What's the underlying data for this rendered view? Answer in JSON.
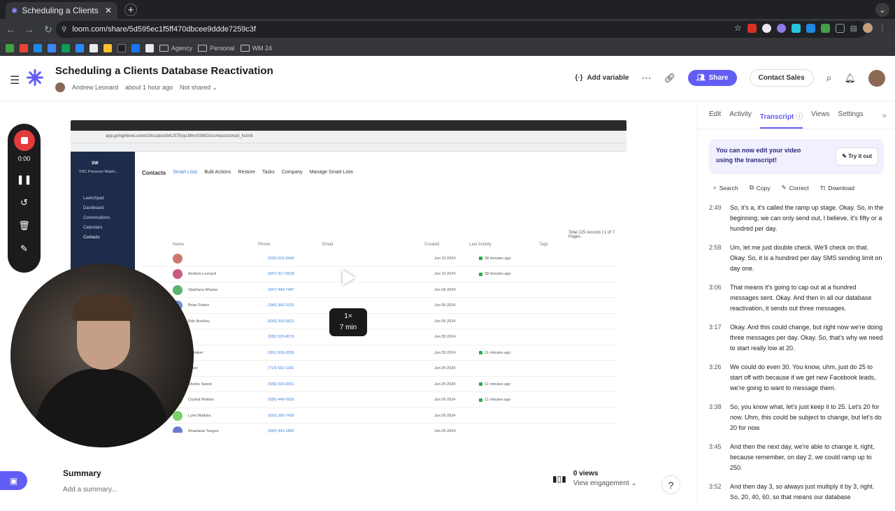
{
  "browser": {
    "tab_title": "Scheduling a Clients Database",
    "url": "loom.com/share/5d595ec1f5ff470dbcee9ddde7259c3f",
    "bookmarks": [
      "Agency",
      "Personal",
      "WM 24"
    ]
  },
  "header": {
    "title": "Scheduling a Clients Database Reactivation",
    "author": "Andrew Leonard",
    "time_ago": "about 1 hour ago",
    "share_status": "Not shared",
    "add_variable": "Add variable",
    "share_label": "Share",
    "contact_sales": "Contact Sales"
  },
  "recorder": {
    "time": "0:00"
  },
  "video": {
    "speed": "1×",
    "duration": "7 min",
    "inner_url": "app.gohighlevel.com/v2/location/bKzS75oyLf8hxXSMGA/contacts/smart_list/All",
    "inner_company": "TRC Pressure Washi...",
    "inner_nav": [
      "Launchpad",
      "Dashboard",
      "Conversations",
      "Calendars",
      "Contacts"
    ],
    "inner_tabs": [
      "Contacts",
      "Smart Lists",
      "Bulk Actions",
      "Restore",
      "Tasks",
      "Company",
      "Manage Smart Lists"
    ],
    "inner_total": "Total 125 records | 1 of 7 Pages",
    "inner_headers": [
      "Name",
      "Phone",
      "Email",
      "Created",
      "Last Activity",
      "Tags"
    ],
    "rows": [
      {
        "name": "",
        "phone": "(936) 525-9440",
        "created": "Jun 10 2024",
        "activity": "38 minutes ago",
        "color": "#c97a6b"
      },
      {
        "name": "Andrew Leonard",
        "phone": "(847) 917-6528",
        "created": "Jun 10 2024",
        "activity": "38 minutes ago",
        "color": "#c85c7a"
      },
      {
        "name": "Stephany Aframe",
        "phone": "(347) 440-7487",
        "created": "Jun 06 2024",
        "activity": "",
        "color": "#5ab36e"
      },
      {
        "name": "Brian Patton",
        "phone": "(346) 366-3102",
        "created": "Jun 06 2024",
        "activity": "",
        "color": "#6b8fd1"
      },
      {
        "name": "Rob Buckley",
        "phone": "(830) 203-9912",
        "created": "Jun 06 2024",
        "activity": "",
        "color": "#d1996b"
      },
      {
        "name": "",
        "phone": "(936) 520-8079",
        "created": "Jun 05 2024",
        "activity": "",
        "color": "#8a6bd1"
      },
      {
        "name": "Whitaker",
        "phone": "(281) 536-0335",
        "created": "Jun 05 2024",
        "activity": "11 minutes ago",
        "color": "#6bb5d1"
      },
      {
        "name": "Zeker",
        "phone": "(713) 562-1166",
        "created": "Jun 05 2024",
        "activity": "",
        "color": "#d16b9e"
      },
      {
        "name": "Shirlee Sweet",
        "phone": "(936) 520-6551",
        "created": "Jun 05 2024",
        "activity": "11 minutes ago",
        "color": "#6bd19e"
      },
      {
        "name": "Crystal Weldon",
        "phone": "(936) 449-0929",
        "created": "Jun 05 2024",
        "activity": "11 minutes ago",
        "color": "#d1c46b"
      },
      {
        "name": "Lynn Watkins",
        "phone": "(816) 390-7430",
        "created": "Jun 05 2024",
        "activity": "",
        "color": "#7ad16b"
      },
      {
        "name": "Anastasia Teague",
        "phone": "(832) 443-1882",
        "created": "Jun 05 2024",
        "activity": "",
        "color": "#6b7ad1"
      }
    ]
  },
  "below": {
    "summary_heading": "Summary",
    "summary_add": "Add a summary...",
    "views_count": "0 views",
    "view_engagement": "View engagement",
    "help": "?"
  },
  "panel": {
    "tabs": [
      "Edit",
      "Activity",
      "Transcript",
      "Views",
      "Settings"
    ],
    "active_tab": "Transcript",
    "notice": "You can now edit your video using the transcript!",
    "try_it": "Try it out",
    "actions": [
      "Search",
      "Copy",
      "Correct",
      "Download"
    ],
    "transcript": [
      {
        "time": "2:49",
        "text": "So, it's a, it's called the ramp up stage. Okay. So, in the beginning, we can only send out, I believe, it's fifty or a hundred per day."
      },
      {
        "time": "2:58",
        "text": "Um, let me just double check. We'll check on that. Okay. So, it is a hundred per day SMS sending limit on day one."
      },
      {
        "time": "3:06",
        "text": "That means it's going to cap out at a hundred messages sent. Okay. And then in all our database reactivation, it sends out three messages."
      },
      {
        "time": "3:17",
        "text": "Okay. And this could change, but right now we're doing three messages per day. Okay. So, that's why we need to start really low at 20."
      },
      {
        "time": "3:26",
        "text": "We could do even 30. You know, uhm, just do 25 to start off with because if we get new Facebook leads, we're going to want to message them."
      },
      {
        "time": "3:38",
        "text": "So, you know what, let's just keep it to 25. Let's 20 for now. Uhm, this could be subject to change, but let's do 20 for now."
      },
      {
        "time": "3:45",
        "text": "And then the next day, we're able to change it, right, because remember, on day 2, we could ramp up to 250."
      },
      {
        "time": "3:52",
        "text": "And then day 3, so always just multiply it by 3, right. So, 20, 40, 60, so that means our database"
      }
    ]
  }
}
